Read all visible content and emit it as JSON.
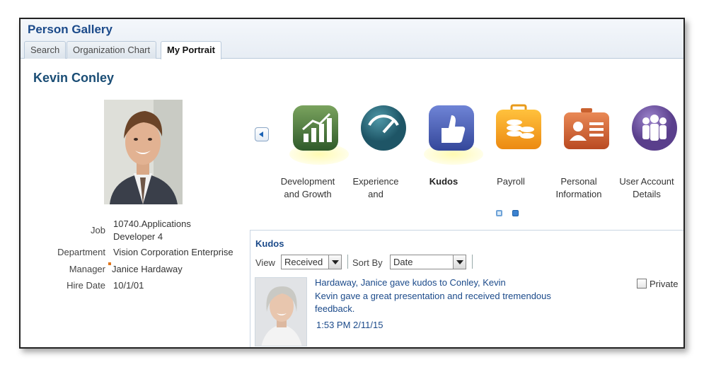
{
  "app": {
    "title": "Person Gallery"
  },
  "tabs": [
    {
      "label": "Search",
      "active": false
    },
    {
      "label": "Organization Chart",
      "active": false
    },
    {
      "label": "My Portrait",
      "active": true
    }
  ],
  "person": {
    "name": "Kevin Conley",
    "details": [
      {
        "label": "Job",
        "value_line1": "10740.Applications",
        "value_line2": "Developer 4"
      },
      {
        "label": "Department",
        "value": "Vision Corporation Enterprise"
      },
      {
        "label": "Manager",
        "value": "Janice Hardaway"
      },
      {
        "label": "Hire Date",
        "value": "10/1/01"
      }
    ]
  },
  "springboard": {
    "apps": [
      {
        "label_line1": "Development",
        "label_line2": "and Growth",
        "icon": "chart-icon",
        "color": "#4e7a3f",
        "selected": false
      },
      {
        "label_line1": "Experience",
        "label_line2": "and",
        "icon": "gauge-icon",
        "color": "#1f6c80",
        "selected": false
      },
      {
        "label_line1": "Kudos",
        "label_line2": "",
        "icon": "thumbs-up-icon",
        "color": "#4b5fb8",
        "selected": true
      },
      {
        "label_line1": "Payroll",
        "label_line2": "",
        "icon": "coins-briefcase-icon",
        "color": "#f0a020",
        "selected": false
      },
      {
        "label_line1": "Personal",
        "label_line2": "Information",
        "icon": "id-badge-icon",
        "color": "#d86a30",
        "selected": false
      },
      {
        "label_line1": "User Account",
        "label_line2": "Details",
        "icon": "people-icon",
        "color": "#7a5ea8",
        "selected": false
      }
    ]
  },
  "kudos": {
    "title": "Kudos",
    "view_label": "View",
    "view_value": "Received",
    "sort_label": "Sort By",
    "sort_value": "Date",
    "entry": {
      "headline": "Hardaway, Janice  gave kudos to  Conley, Kevin",
      "message": "Kevin gave a great presentation and received tremendous feedback.",
      "time": "1:53 PM  2/11/15",
      "private_label": "Private"
    }
  }
}
